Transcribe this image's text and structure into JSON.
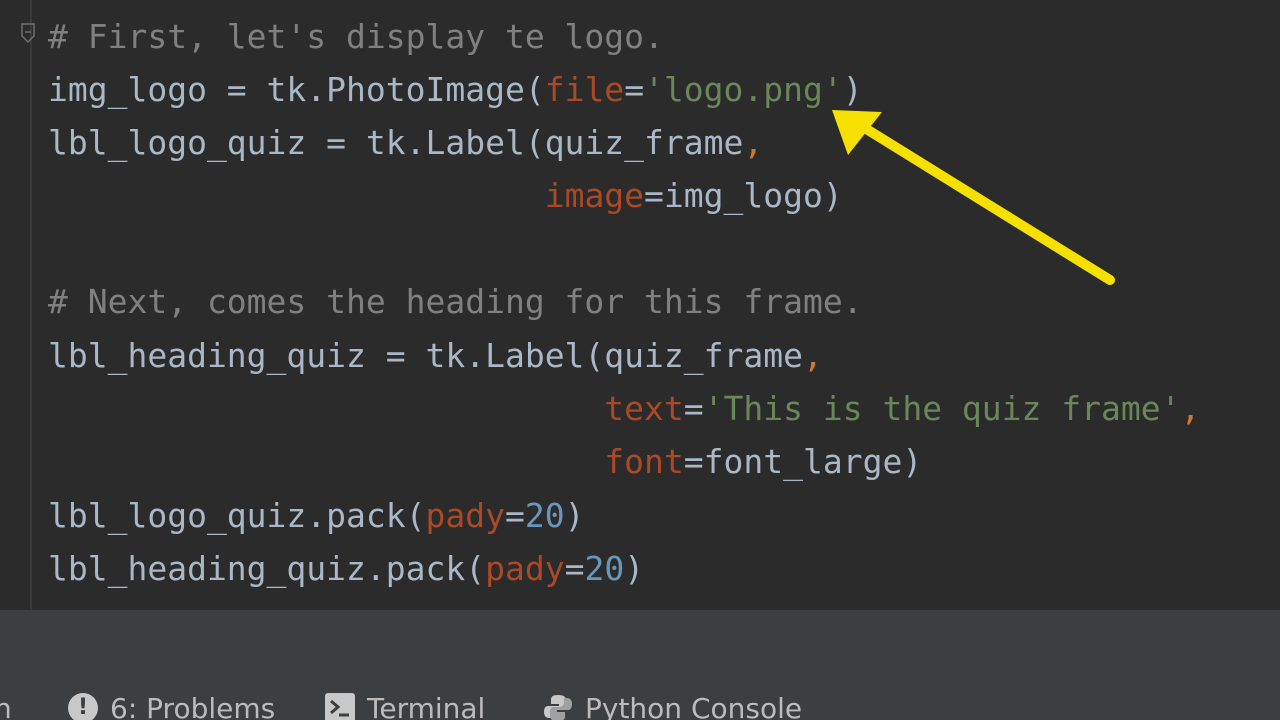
{
  "editor": {
    "lines": [
      {
        "segments": [
          {
            "t": "# First, let's display te logo.",
            "c": "cm"
          }
        ]
      },
      {
        "segments": [
          {
            "t": "img_logo = tk.PhotoImage(",
            "c": "tx"
          },
          {
            "t": "file",
            "c": "pa"
          },
          {
            "t": "=",
            "c": "tx"
          },
          {
            "t": "'logo.png'",
            "c": "st"
          },
          {
            "t": ")",
            "c": "tx"
          }
        ]
      },
      {
        "segments": [
          {
            "t": "lbl_logo_quiz = tk.Label(quiz_frame",
            "c": "tx"
          },
          {
            "t": ",",
            "c": "kw"
          }
        ]
      },
      {
        "segments": [
          {
            "t": "                         ",
            "c": "tx"
          },
          {
            "t": "image",
            "c": "pa"
          },
          {
            "t": "=img_logo)",
            "c": "tx"
          }
        ]
      },
      {
        "segments": [
          {
            "t": "",
            "c": "tx"
          }
        ]
      },
      {
        "segments": [
          {
            "t": "# Next, comes the heading for this frame.",
            "c": "cm"
          }
        ]
      },
      {
        "segments": [
          {
            "t": "lbl_heading_quiz = tk.Label(quiz_frame",
            "c": "tx"
          },
          {
            "t": ",",
            "c": "kw"
          }
        ]
      },
      {
        "segments": [
          {
            "t": "                            ",
            "c": "tx"
          },
          {
            "t": "text",
            "c": "pa"
          },
          {
            "t": "=",
            "c": "tx"
          },
          {
            "t": "'This is the quiz frame'",
            "c": "st"
          },
          {
            "t": ",",
            "c": "kw"
          }
        ]
      },
      {
        "segments": [
          {
            "t": "                            ",
            "c": "tx"
          },
          {
            "t": "font",
            "c": "pa"
          },
          {
            "t": "=font_large)",
            "c": "tx"
          }
        ]
      },
      {
        "segments": [
          {
            "t": "lbl_logo_quiz.pack(",
            "c": "tx"
          },
          {
            "t": "pady",
            "c": "pa"
          },
          {
            "t": "=",
            "c": "tx"
          },
          {
            "t": "20",
            "c": "nu"
          },
          {
            "t": ")",
            "c": "tx"
          }
        ]
      },
      {
        "segments": [
          {
            "t": "lbl_heading_quiz.pack(",
            "c": "tx"
          },
          {
            "t": "pady",
            "c": "pa"
          },
          {
            "t": "=",
            "c": "tx"
          },
          {
            "t": "20",
            "c": "nu"
          },
          {
            "t": ")",
            "c": "tx"
          }
        ]
      }
    ]
  },
  "statusbar": {
    "partial_tab": "n",
    "problems_label": "6: Problems",
    "terminal_label": "Terminal",
    "python_console_label": "Python Console",
    "problems_icon": "exclamation-circle-icon",
    "terminal_icon": "terminal-icon",
    "python_icon": "python-icon"
  },
  "annotation": {
    "arrow_color": "#f5e000"
  }
}
